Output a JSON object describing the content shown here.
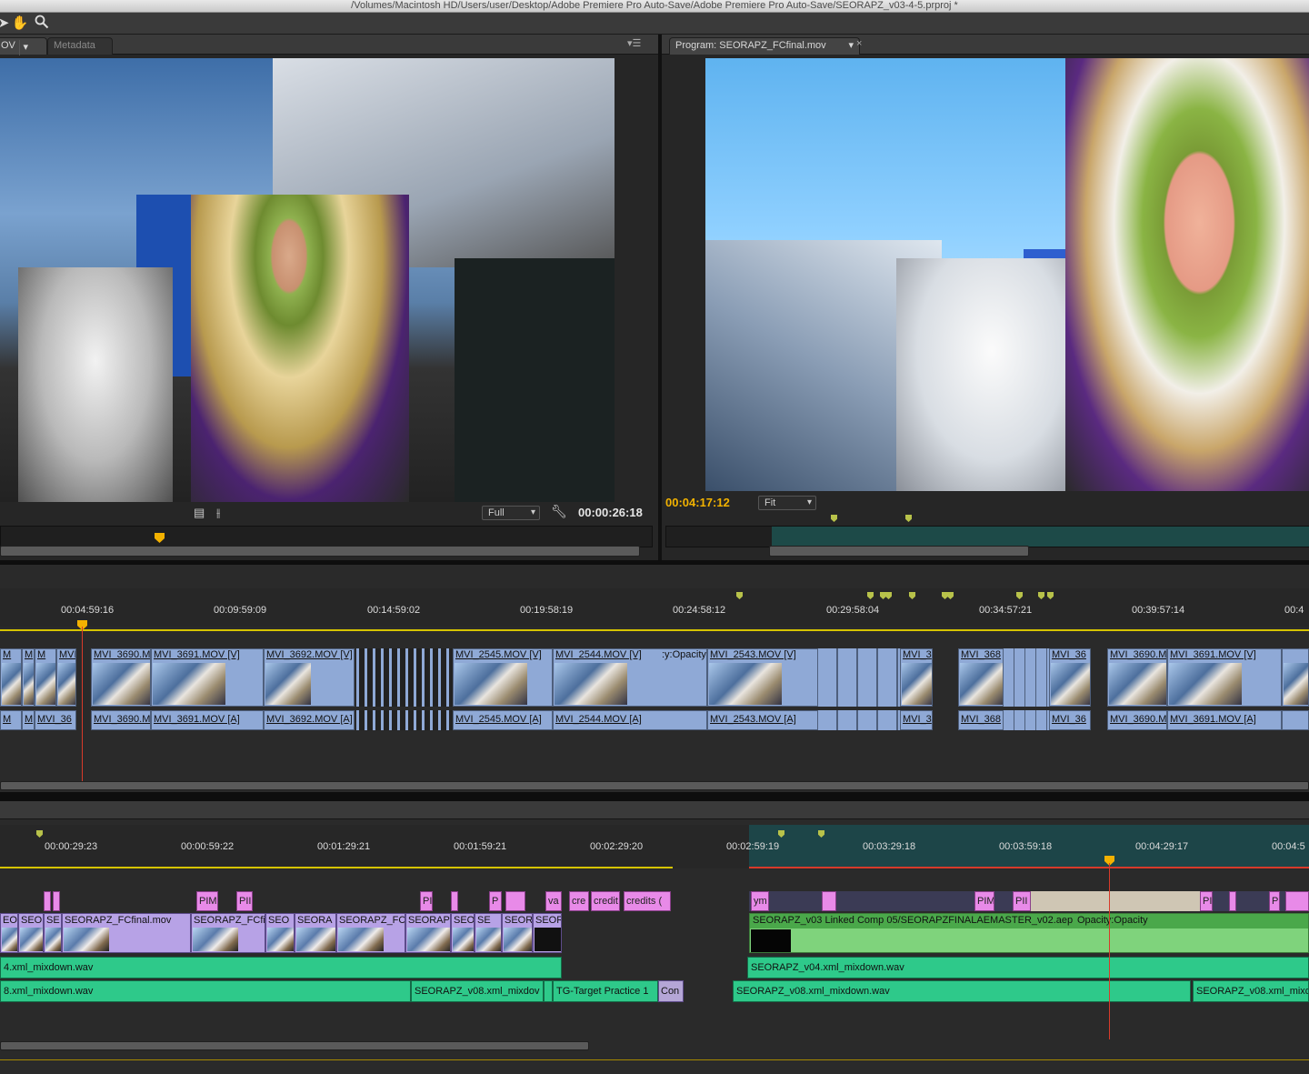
{
  "window": {
    "title": "/Volumes/Macintosh HD/Users/user/Desktop/Adobe Premiere Pro Auto-Save/Adobe Premiere Pro Auto-Save/SEORAPZ_v03-4-5.prproj *"
  },
  "toolbar": {
    "tools": [
      "selection-tool",
      "hand-tool",
      "zoom-tool"
    ]
  },
  "source_monitor": {
    "tab_label": "OV",
    "tab2_label": "Metadata",
    "zoom": "Full",
    "timecode": "00:00:26:18"
  },
  "program_monitor": {
    "tab_label": "Program: SEORAPZ_FCfinal.mov",
    "zoom": "Fit",
    "timecode": "00:04:17:12"
  },
  "timeline1": {
    "ruler": [
      "00:04:59:16",
      "00:09:59:09",
      "00:14:59:02",
      "00:19:58:19",
      "00:24:58:12",
      "00:29:58:04",
      "00:34:57:21",
      "00:39:57:14",
      "00:4"
    ],
    "video_clips": [
      {
        "label": "M"
      },
      {
        "label": "M"
      },
      {
        "label": "M"
      },
      {
        "label": "MVI_36"
      },
      {
        "label": "MVI_3690.M"
      },
      {
        "label": "MVI_3691.MOV [V]"
      },
      {
        "label": "MVI_3692.MOV [V]"
      },
      {
        "label": "MVI_2545.MOV [V]"
      },
      {
        "label": "MVI_2544.MOV [V]"
      },
      {
        "label": "MVI_2543.MOV [V]"
      },
      {
        "label": "MVI_3"
      },
      {
        "label": "MVI_368"
      },
      {
        "label": "MVI_36"
      },
      {
        "label": "MVI_3690.M"
      },
      {
        "label": "MVI_3691.MOV [V]"
      }
    ],
    "opacity_label": ":y:Opacity",
    "audio_clips": [
      {
        "label": "M"
      },
      {
        "label": "M"
      },
      {
        "label": "MVI_36"
      },
      {
        "label": "MVI_3690.M"
      },
      {
        "label": "MVI_3691.MOV [A]"
      },
      {
        "label": "MVI_3692.MOV [A]"
      },
      {
        "label": "MVI_2545.MOV [A]"
      },
      {
        "label": "MVI_2544.MOV [A]"
      },
      {
        "label": "MVI_2543.MOV [A]"
      },
      {
        "label": "MVI_3"
      },
      {
        "label": "MVI_368"
      },
      {
        "label": "MVI_36"
      },
      {
        "label": "MVI_3690.M"
      },
      {
        "label": "MVI_3691.MOV [A]"
      }
    ]
  },
  "timeline2": {
    "ruler": [
      "00:00:29:23",
      "00:00:59:22",
      "00:01:29:21",
      "00:01:59:21",
      "00:02:29:20",
      "00:02:59:19",
      "00:03:29:18",
      "00:03:59:18",
      "00:04:29:17",
      "00:04:5"
    ],
    "title_clips": [
      "PIM",
      "PII",
      "PI",
      "P",
      "va",
      "cre",
      "credit",
      "credits (",
      "ym",
      "PIM",
      "PII",
      "PI",
      "P"
    ],
    "video_clips": [
      "EO",
      "SEOI",
      "SE",
      "SEORAPZ_FCfinal.mov",
      "SEORAPZ_FCfi",
      "SEO",
      "SEORA",
      "SEORAPZ_FC",
      "SEORAP",
      "SEO",
      "SE",
      "SEOR",
      "SEOR"
    ],
    "linked_comp": "SEORAPZ_v03 Linked Comp 05/SEORAPZFINALAEMASTER_v02.aep",
    "linked_opacity": "Opacity:Opacity",
    "audio1": [
      "4.xml_mixdown.wav",
      "SEORAPZ_v04.xml_mixdown.wav"
    ],
    "audio2": [
      "8.xml_mixdown.wav",
      "SEORAPZ_v08.xml_mixdov",
      "TG-Target Practice 1",
      "Con",
      "SEORAPZ_v08.xml_mixdown.wav",
      "SEORAPZ_v08.xml_mixdown"
    ]
  },
  "colors": {
    "playhead": "#f3b100",
    "timecode": "#f2b200",
    "marker": "#b8c24a",
    "video_clip": "#8fa9d6",
    "audio_green": "#2ec98a",
    "title_pink": "#e88ae8"
  }
}
